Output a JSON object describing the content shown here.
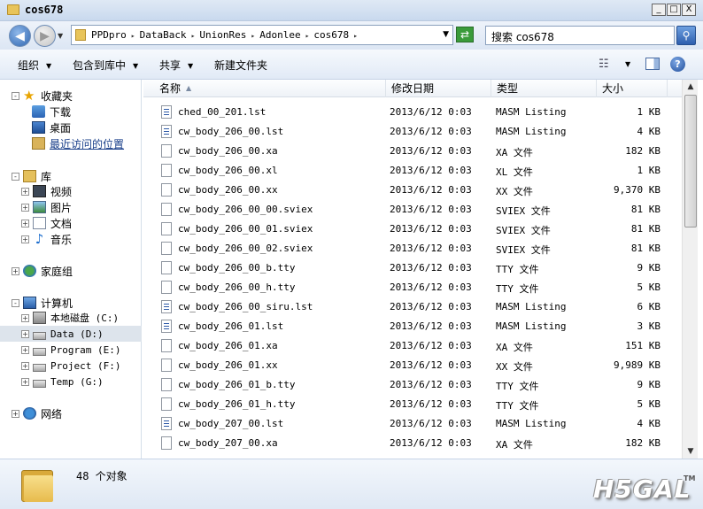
{
  "window": {
    "title": "cos678",
    "controls": {
      "minimize": "_",
      "maximize": "□",
      "close": "X"
    }
  },
  "address": {
    "crumbs": [
      "PPDpro",
      "DataBack",
      "UnionRes",
      "Adonlee",
      "cos678"
    ],
    "search_placeholder": "搜索 cos678"
  },
  "toolbar": {
    "organize": "组织",
    "include_in_library": "包含到库中",
    "share": "共享",
    "new_folder": "新建文件夹"
  },
  "nav": {
    "favorites": {
      "label": "收藏夹",
      "items": [
        "下载",
        "桌面",
        "最近访问的位置"
      ]
    },
    "libraries": {
      "label": "库",
      "items": [
        "视频",
        "图片",
        "文档",
        "音乐"
      ]
    },
    "homegroup": "家庭组",
    "computer": {
      "label": "计算机",
      "items": [
        "本地磁盘 (C:)",
        "Data (D:)",
        "Program (E:)",
        "Project (F:)",
        "Temp (G:)"
      ]
    },
    "network": "网络"
  },
  "columns": {
    "name": "名称",
    "date": "修改日期",
    "type": "类型",
    "size": "大小"
  },
  "files": [
    {
      "name": "ched_00_201.lst",
      "date": "2013/6/12 0:03",
      "type": "MASM Listing",
      "size": "1 KB",
      "icon": "lst"
    },
    {
      "name": "cw_body_206_00.lst",
      "date": "2013/6/12 0:03",
      "type": "MASM Listing",
      "size": "4 KB",
      "icon": "lst"
    },
    {
      "name": "cw_body_206_00.xa",
      "date": "2013/6/12 0:03",
      "type": "XA 文件",
      "size": "182 KB",
      "icon": "file"
    },
    {
      "name": "cw_body_206_00.xl",
      "date": "2013/6/12 0:03",
      "type": "XL 文件",
      "size": "1 KB",
      "icon": "file"
    },
    {
      "name": "cw_body_206_00.xx",
      "date": "2013/6/12 0:03",
      "type": "XX 文件",
      "size": "9,370 KB",
      "icon": "file"
    },
    {
      "name": "cw_body_206_00_00.sviex",
      "date": "2013/6/12 0:03",
      "type": "SVIEX 文件",
      "size": "81 KB",
      "icon": "file"
    },
    {
      "name": "cw_body_206_00_01.sviex",
      "date": "2013/6/12 0:03",
      "type": "SVIEX 文件",
      "size": "81 KB",
      "icon": "file"
    },
    {
      "name": "cw_body_206_00_02.sviex",
      "date": "2013/6/12 0:03",
      "type": "SVIEX 文件",
      "size": "81 KB",
      "icon": "file"
    },
    {
      "name": "cw_body_206_00_b.tty",
      "date": "2013/6/12 0:03",
      "type": "TTY 文件",
      "size": "9 KB",
      "icon": "file"
    },
    {
      "name": "cw_body_206_00_h.tty",
      "date": "2013/6/12 0:03",
      "type": "TTY 文件",
      "size": "5 KB",
      "icon": "file"
    },
    {
      "name": "cw_body_206_00_siru.lst",
      "date": "2013/6/12 0:03",
      "type": "MASM Listing",
      "size": "6 KB",
      "icon": "lst"
    },
    {
      "name": "cw_body_206_01.lst",
      "date": "2013/6/12 0:03",
      "type": "MASM Listing",
      "size": "3 KB",
      "icon": "lst"
    },
    {
      "name": "cw_body_206_01.xa",
      "date": "2013/6/12 0:03",
      "type": "XA 文件",
      "size": "151 KB",
      "icon": "file"
    },
    {
      "name": "cw_body_206_01.xx",
      "date": "2013/6/12 0:03",
      "type": "XX 文件",
      "size": "9,989 KB",
      "icon": "file"
    },
    {
      "name": "cw_body_206_01_b.tty",
      "date": "2013/6/12 0:03",
      "type": "TTY 文件",
      "size": "9 KB",
      "icon": "file"
    },
    {
      "name": "cw_body_206_01_h.tty",
      "date": "2013/6/12 0:03",
      "type": "TTY 文件",
      "size": "5 KB",
      "icon": "file"
    },
    {
      "name": "cw_body_207_00.lst",
      "date": "2013/6/12 0:03",
      "type": "MASM Listing",
      "size": "4 KB",
      "icon": "lst"
    },
    {
      "name": "cw_body_207_00.xa",
      "date": "2013/6/12 0:03",
      "type": "XA 文件",
      "size": "182 KB",
      "icon": "file"
    }
  ],
  "status": {
    "count": "48 个对象"
  },
  "watermark": {
    "text": "H5GAL",
    "tm": "TM"
  }
}
